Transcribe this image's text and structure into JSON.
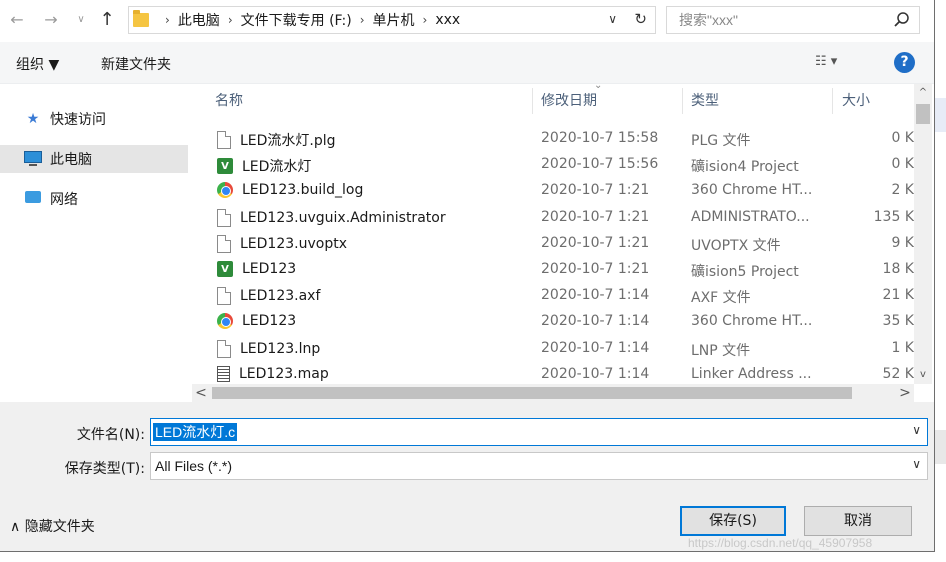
{
  "address_bar": {
    "back": "←",
    "forward": "→",
    "history": "∨",
    "up": "↑",
    "crumbs": [
      "此电脑",
      "文件下载专用 (F:)",
      "单片机",
      "xxx"
    ],
    "separator": "›",
    "dropdown": "∨",
    "refresh": "↻",
    "search_placeholder": "搜索\"xxx\""
  },
  "toolbar": {
    "organize": "组织 ▼",
    "new_folder": "新建文件夹",
    "view": "☷ ▾",
    "help": "?"
  },
  "sidebar": {
    "items": [
      {
        "label": "快速访问",
        "icon": "star-icon"
      },
      {
        "label": "此电脑",
        "icon": "computer-icon",
        "selected": true
      },
      {
        "label": "网络",
        "icon": "network-icon"
      }
    ]
  },
  "columns": {
    "name": "名称",
    "date": "修改日期",
    "type": "类型",
    "size": "大小"
  },
  "files": [
    {
      "name": "LED流水灯.plg",
      "date": "2020-10-7 15:58",
      "type": "PLG 文件",
      "size": "0 K",
      "icon": "doc"
    },
    {
      "name": "LED流水灯",
      "date": "2020-10-7 15:56",
      "type": "礦ision4 Project",
      "size": "0 K",
      "icon": "uv"
    },
    {
      "name": "LED123.build_log",
      "date": "2020-10-7 1:21",
      "type": "360 Chrome HT...",
      "size": "2 K",
      "icon": "chrome"
    },
    {
      "name": "LED123.uvguix.Administrator",
      "date": "2020-10-7 1:21",
      "type": "ADMINISTRATO...",
      "size": "135 K",
      "icon": "doc"
    },
    {
      "name": "LED123.uvoptx",
      "date": "2020-10-7 1:21",
      "type": "UVOPTX 文件",
      "size": "9 K",
      "icon": "doc"
    },
    {
      "name": "LED123",
      "date": "2020-10-7 1:21",
      "type": "礦ision5 Project",
      "size": "18 K",
      "icon": "uv"
    },
    {
      "name": "LED123.axf",
      "date": "2020-10-7 1:14",
      "type": "AXF 文件",
      "size": "21 K",
      "icon": "doc"
    },
    {
      "name": "LED123",
      "date": "2020-10-7 1:14",
      "type": "360 Chrome HT...",
      "size": "35 K",
      "icon": "chrome"
    },
    {
      "name": "LED123.lnp",
      "date": "2020-10-7 1:14",
      "type": "LNP 文件",
      "size": "1 K",
      "icon": "doc"
    },
    {
      "name": "LED123.map",
      "date": "2020-10-7 1:14",
      "type": "Linker Address ...",
      "size": "52 K",
      "icon": "map"
    }
  ],
  "scrollbar": {
    "up": "^",
    "down": "v",
    "left": "<",
    "right": ">"
  },
  "bottom": {
    "filename_label": "文件名(N):",
    "filename_value": "LED流水灯.c",
    "filetype_label": "保存类型(T):",
    "filetype_value": "All Files (*.*)",
    "dropdown": "∨",
    "hide_folders": "∧ 隐藏文件夹",
    "save": "保存(S)",
    "cancel": "取消",
    "watermark": "https://blog.csdn.net/qq_45907958"
  }
}
